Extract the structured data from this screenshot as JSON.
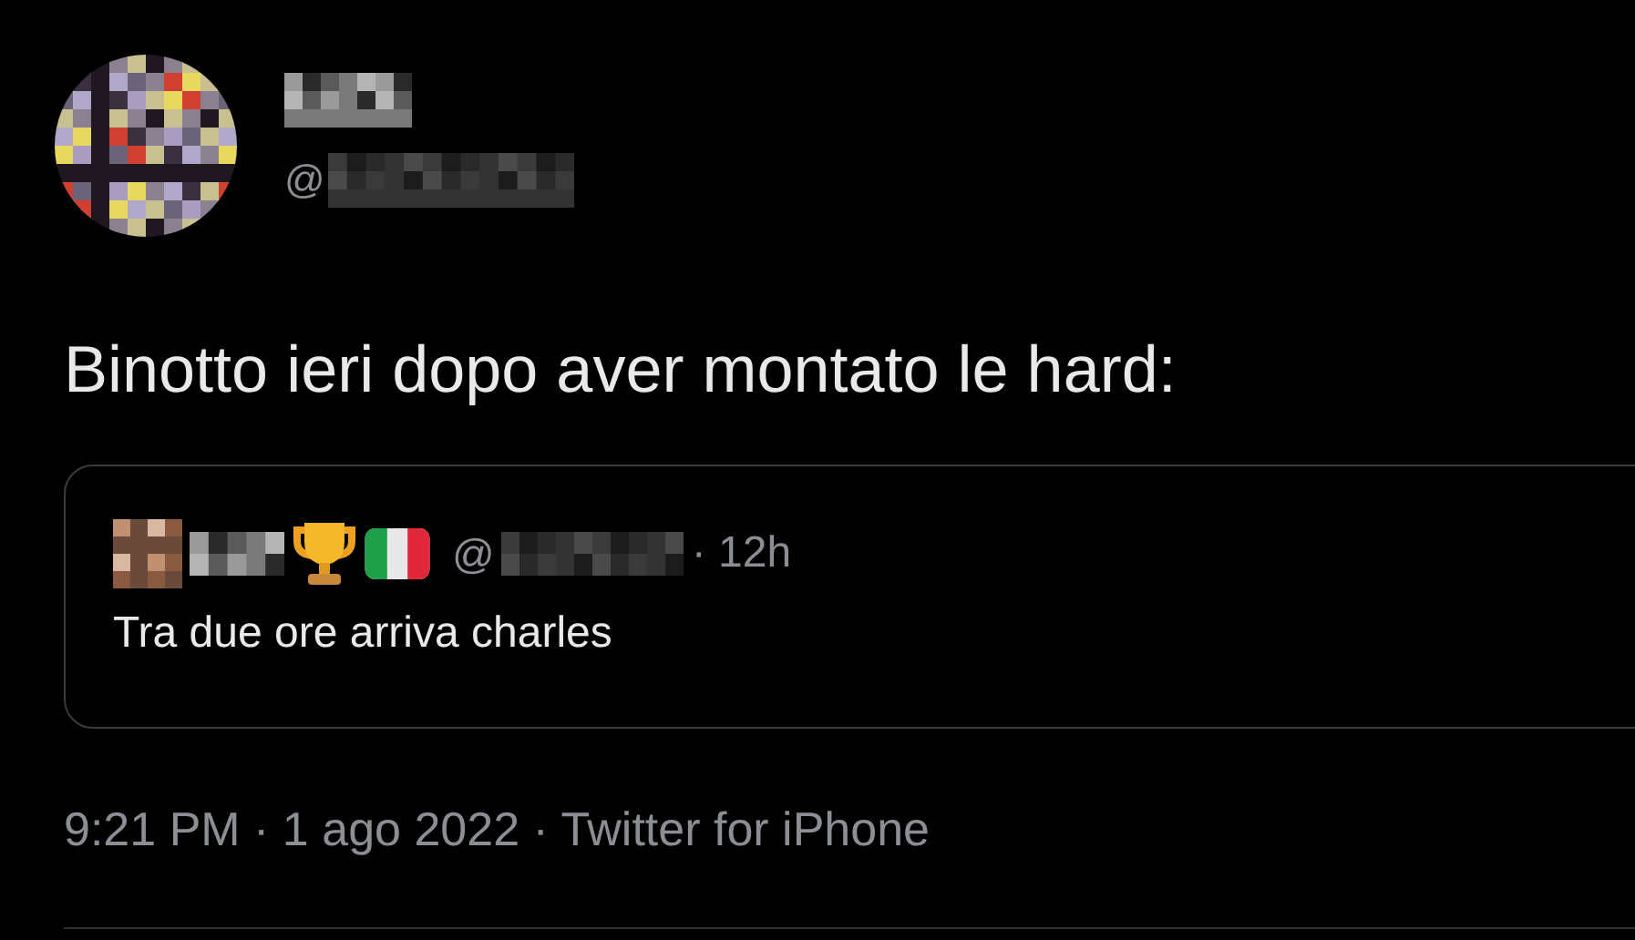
{
  "tweet": {
    "author": {
      "handle_prefix": "@"
    },
    "text": "Binotto ieri dopo aver montato le hard:",
    "quoted_tweet": {
      "author": {
        "handle_prefix": "@"
      },
      "time": "· 12h",
      "text": "Tra due ore arriva charles"
    },
    "footer": "9:21 PM · 1 ago 2022 · Twitter for iPhone"
  }
}
